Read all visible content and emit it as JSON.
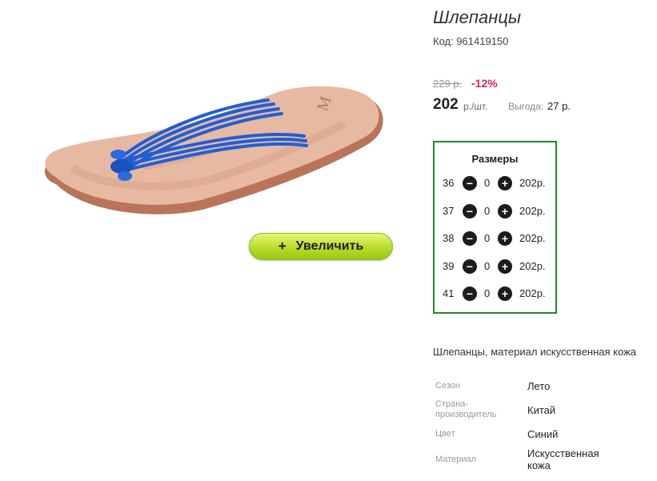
{
  "product": {
    "title": "Шлепанцы",
    "code": "Код: 961419150",
    "old_price": "229 р.",
    "discount": "-12%",
    "price": "202",
    "unit": "р./шт.",
    "saving_label": "Выгода:",
    "saving_value": "27 р.",
    "description": "Шлепанцы, материал искусственная кожа"
  },
  "zoom_button": {
    "icon": "+",
    "label": "Увеличить"
  },
  "sizes": {
    "title": "Размеры",
    "rows": [
      {
        "size": "36",
        "qty": "0",
        "price": "202р."
      },
      {
        "size": "37",
        "qty": "0",
        "price": "202р."
      },
      {
        "size": "38",
        "qty": "0",
        "price": "202р."
      },
      {
        "size": "39",
        "qty": "0",
        "price": "202р."
      },
      {
        "size": "41",
        "qty": "0",
        "price": "202р."
      }
    ]
  },
  "attributes": [
    {
      "label": "Сезон",
      "value": "Лето"
    },
    {
      "label": "Страна-\nпроизводитель",
      "value": "Китай"
    },
    {
      "label": "Цвет",
      "value": "Синий"
    },
    {
      "label": "Материал",
      "value": "Искусственная кожа"
    }
  ],
  "colors": {
    "accent_border": "#1e8a2a",
    "discount": "#e0245e",
    "button": "#b9dc2c"
  },
  "icons": {
    "minus": "minus-circle-icon",
    "plus": "plus-circle-icon"
  }
}
